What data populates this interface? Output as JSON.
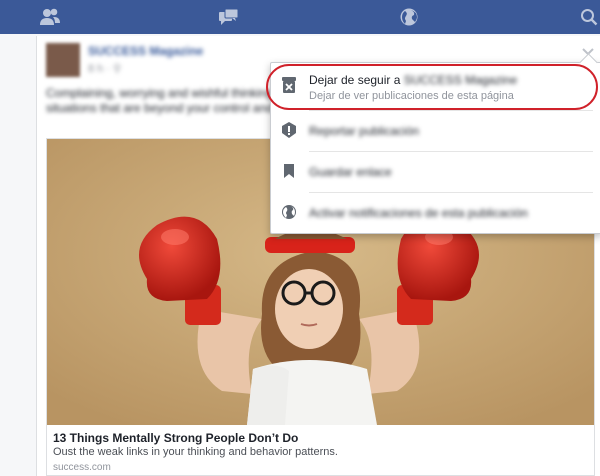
{
  "topbar": {
    "color": "#3b5998",
    "icons": [
      "friends-icon",
      "messages-icon",
      "globe-icon",
      "search-icon"
    ]
  },
  "post": {
    "author": "SUCCESS Magazine",
    "meta": "8 h · ⚲",
    "text": "Complaining, worrying and wishful thinking situations that are beyond your control and you.",
    "link": {
      "title": "13 Things Mentally Strong People Don’t Do",
      "description": "Oust the weak links in your thinking and behavior patterns.",
      "domain": "success.com"
    }
  },
  "menu": {
    "unfollow": {
      "label_prefix": "Dejar de seguir a",
      "page_name": "SUCCESS Magazine",
      "sublabel": "Dejar de ver publicaciones de esta página"
    },
    "report": "Reportar publicación",
    "save": "Guardar enlace",
    "notify": "Activar notificaciones de esta publicación"
  },
  "highlight_color": "#d0212a"
}
